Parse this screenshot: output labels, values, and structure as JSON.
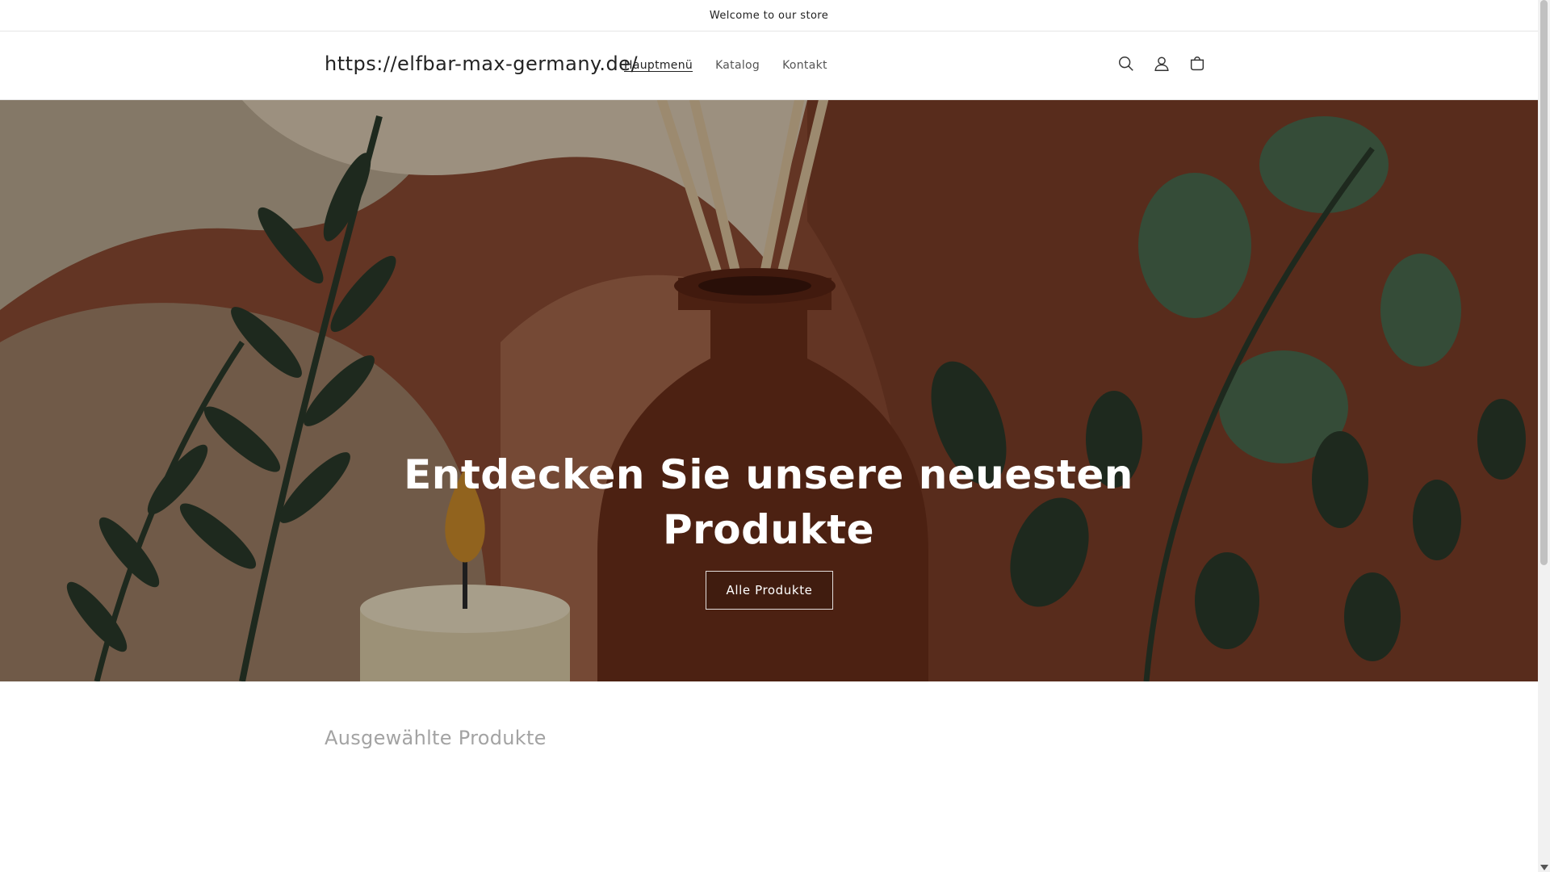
{
  "announcement": {
    "text": "Welcome to our store"
  },
  "header": {
    "logo_text": "https://elfbar-max-germany.de/",
    "nav": [
      {
        "label": "Hauptmenü",
        "active": true
      },
      {
        "label": "Katalog",
        "active": false
      },
      {
        "label": "Kontakt",
        "active": false
      }
    ],
    "icons": [
      "search-icon",
      "account-icon",
      "cart-icon"
    ]
  },
  "hero": {
    "title": "Entdecken Sie unsere neuesten Produkte",
    "button_label": "Alle Produkte"
  },
  "featured": {
    "title": "Ausgewählte Produkte"
  },
  "colors": {
    "hero_background": "#8a4a33",
    "leaf_dark": "#2a3a2a",
    "leaf_green": "#4a6a4e",
    "vase": "#6a2e1a",
    "candle": "#d9c9a6",
    "flame": "#c98a2a"
  }
}
